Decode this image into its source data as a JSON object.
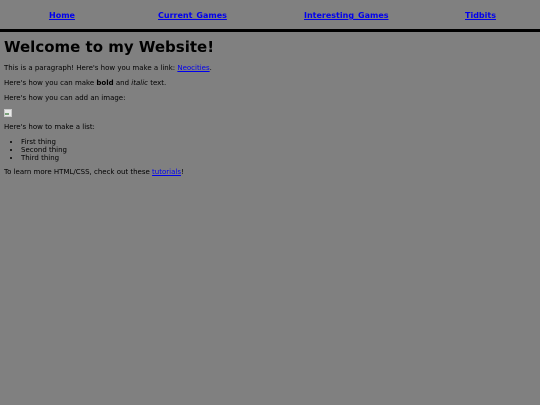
{
  "nav": {
    "home": "Home",
    "current_games": "Current_Games",
    "interesting_games": "Interesting_Games",
    "tidbits": "Tidbits"
  },
  "main": {
    "heading": "Welcome to my Website!",
    "p1_text": "This is a paragraph! Here's how you make a link: ",
    "p1_link": "Neocities",
    "p1_end": ".",
    "p2_a": "Here's how you can make ",
    "p2_bold": "bold",
    "p2_b": " and ",
    "p2_italic": "italic",
    "p2_c": " text.",
    "p3_text": "Here's how you can add an image:",
    "p4_text": "Here's how to make a list:",
    "list_items": [
      "First thing",
      "Second thing",
      "Third thing"
    ],
    "p5_text": "To learn more HTML/CSS, check out these ",
    "p5_link": "tutorials",
    "p5_end": "!"
  },
  "colors": {
    "background": "#808080",
    "link": "#0000ee",
    "divider": "#000000"
  }
}
